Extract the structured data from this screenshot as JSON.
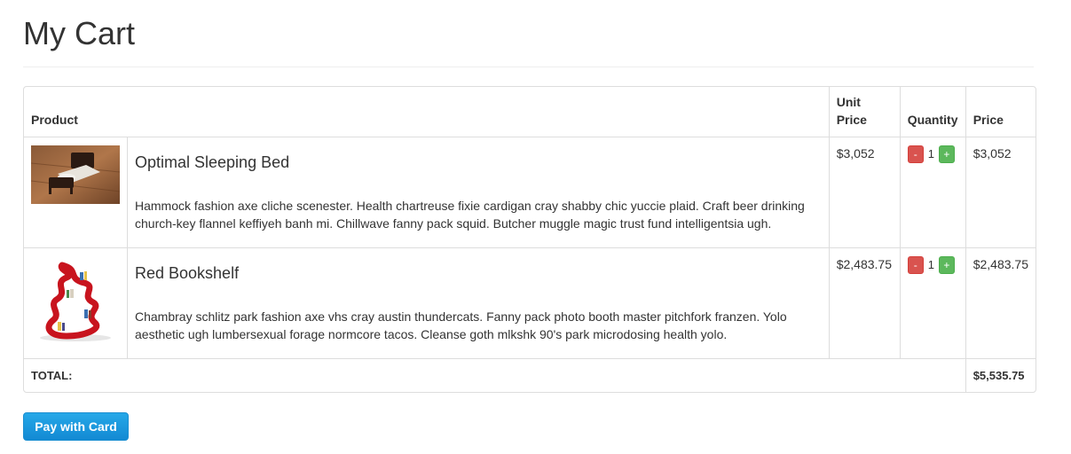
{
  "page": {
    "title": "My Cart"
  },
  "table": {
    "headers": {
      "product": "Product",
      "unit_price": "Unit Price",
      "quantity": "Quantity",
      "price": "Price"
    },
    "items": [
      {
        "name": "Optimal Sleeping Bed",
        "description": "Hammock fashion axe cliche scenester. Health chartreuse fixie cardigan cray shabby chic yuccie plaid. Craft beer drinking church-key flannel keffiyeh banh mi. Chillwave fanny pack squid. Butcher muggle magic trust fund intelligentsia ugh.",
        "unit_price": "$3,052",
        "quantity": "1",
        "price": "$3,052",
        "image": "bed-photo"
      },
      {
        "name": "Red Bookshelf",
        "description": "Chambray schlitz park fashion axe vhs cray austin thundercats. Fanny pack photo booth master pitchfork franzen. Yolo aesthetic ugh lumbersexual forage normcore tacos. Cleanse goth mlkshk 90's park microdosing health yolo.",
        "unit_price": "$2,483.75",
        "quantity": "1",
        "price": "$2,483.75",
        "image": "red-bookshelf-photo"
      }
    ],
    "minus_label": "-",
    "plus_label": "+",
    "total_label": "TOTAL:",
    "total_value": "$5,535.75"
  },
  "actions": {
    "pay_label": "Pay with Card"
  },
  "colors": {
    "minus_button": "#d9534f",
    "plus_button": "#5cb85c",
    "pay_button": "#1a9be0"
  }
}
